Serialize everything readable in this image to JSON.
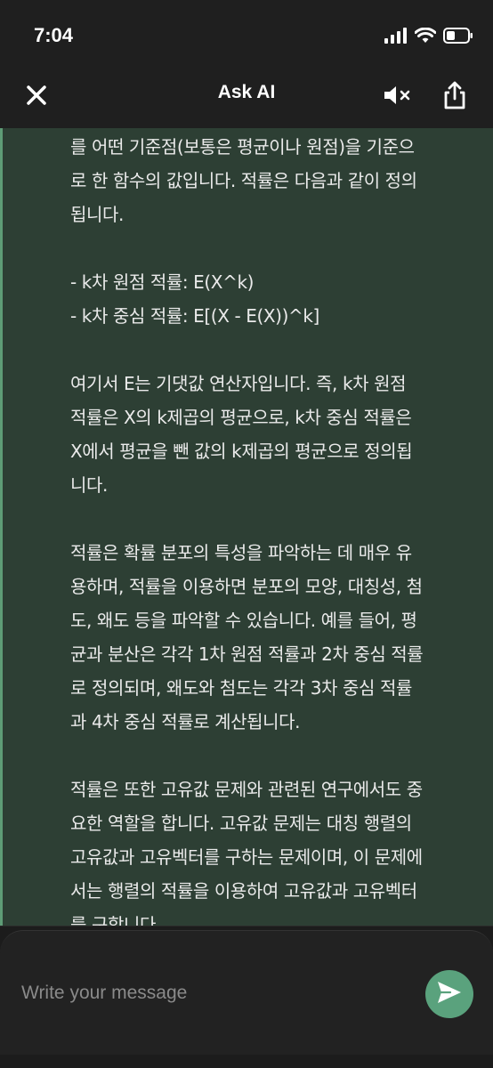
{
  "status_bar": {
    "time": "7:04",
    "icons": [
      "signal-icon",
      "wifi-icon",
      "battery-icon"
    ]
  },
  "header": {
    "title": "Ask AI",
    "close_icon": "close-icon",
    "mute_icon": "speaker-mute-icon",
    "share_icon": "share-icon"
  },
  "message": {
    "paragraphs": [
      {
        "lines": [
          "를 어떤 기준점(보통은 평균이나 원점)을 기준으",
          "로 한 함수의 값입니다. 적률은 다음과 같이 정의",
          "됩니다."
        ]
      },
      {
        "lines": [
          "- k차 원점 적률: E(X^k)",
          "- k차 중심 적률: E[(X - E(X))^k]"
        ]
      },
      {
        "lines": [
          "여기서 E는 기댓값 연산자입니다. 즉, k차 원점",
          "적률은 X의 k제곱의 평균으로, k차 중심 적률은",
          "X에서 평균을 뺀 값의 k제곱의 평균으로 정의됩",
          "니다."
        ]
      },
      {
        "lines": [
          "적률은 확률 분포의 특성을 파악하는 데 매우 유",
          "용하며, 적률을 이용하면 분포의 모양, 대칭성, 첨",
          "도, 왜도 등을 파악할 수 있습니다. 예를 들어, 평",
          "균과 분산은 각각 1차 원점 적률과 2차 중심 적률",
          "로 정의되며, 왜도와 첨도는 각각 3차 중심 적률",
          "과 4차 중심 적률로 계산됩니다."
        ]
      },
      {
        "lines": [
          "적률은 또한 고유값 문제와 관련된 연구에서도 중",
          "요한 역할을 합니다. 고유값 문제는 대칭 행렬의",
          "고유값과 고유벡터를 구하는 문제이며, 이 문제에",
          "서는 행렬의 적률을 이용하여 고유값과 고유벡터",
          "를 구합니다."
        ]
      }
    ]
  },
  "composer": {
    "placeholder": "Write your message",
    "value": "",
    "send_icon": "send-icon"
  },
  "colors": {
    "bubble_bg": "#2d3f34",
    "accent": "#5aa27d",
    "background": "#1e1e1e"
  }
}
